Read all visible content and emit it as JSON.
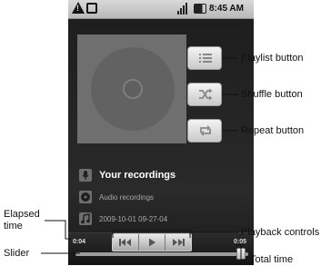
{
  "status_bar": {
    "time": "8:45 AM"
  },
  "now_playing": {
    "title": "Your recordings",
    "album": "Audio recordings",
    "track": "2009-10-01 09-27-04"
  },
  "playback": {
    "elapsed": "0:04",
    "total": "0:05",
    "progress": 0.9
  },
  "callouts": {
    "playlist": "Playlist button",
    "shuffle": "Shuffle button",
    "repeat": "Repeat button",
    "elapsed_line1": "Elapsed",
    "elapsed_line2": "time",
    "slider": "Slider",
    "playback_controls": "Playback controls",
    "total_time": "Total time"
  },
  "icons": {
    "playlist": "playlist-icon",
    "shuffle": "shuffle-icon",
    "repeat": "repeat-icon",
    "previous": "previous-icon",
    "play": "play-icon",
    "next": "next-icon"
  }
}
